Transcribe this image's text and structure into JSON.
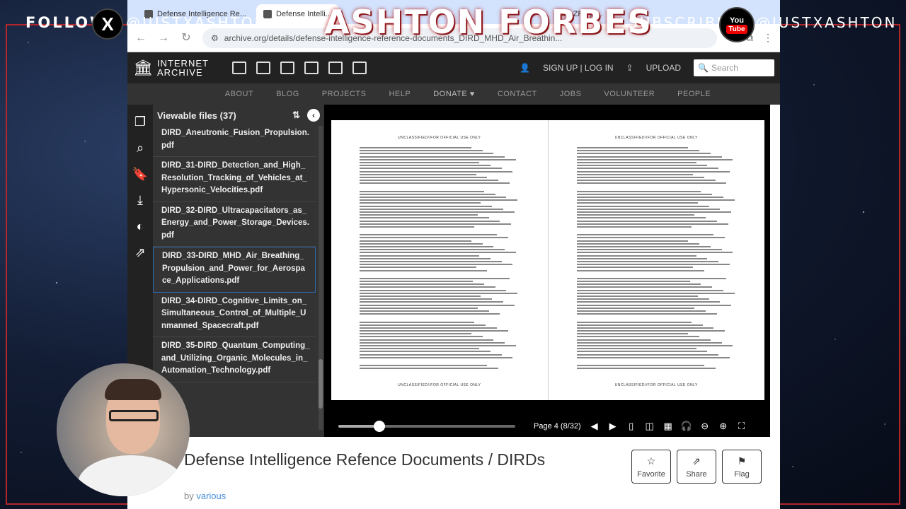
{
  "overlay": {
    "follow_label": "FOLLOW",
    "x_logo": "X",
    "handle_left": "@JUSTXASHTON",
    "title": "ASHTON FORBES",
    "subscribe_label": "SUBSCRIBE",
    "yt_top": "You",
    "yt_bottom": "Tube",
    "handle_right": "@JUSTXASHTON"
  },
  "browser": {
    "tabs": [
      {
        "label": "Defense Intelligence Re..."
      },
      {
        "label": "Defense Intelli..."
      },
      {
        "label": "d's ZPF pr..."
      }
    ],
    "url": "archive.org/details/defense-intelligence-reference-documents_DIRD_MHD_Air_Breathin..."
  },
  "ia": {
    "logo_line1": "INTERNET",
    "logo_line2": "ARCHIVE",
    "signup": "SIGN UP | LOG IN",
    "upload": "UPLOAD",
    "search_placeholder": "Search",
    "nav": [
      "ABOUT",
      "BLOG",
      "PROJECTS",
      "HELP",
      "DONATE ♥",
      "CONTACT",
      "JOBS",
      "VOLUNTEER",
      "PEOPLE"
    ]
  },
  "files": {
    "header": "Viewable files (37)",
    "items": [
      {
        "name": "DIRD_Aneutronic_Fusion_Propulsion.pdf"
      },
      {
        "name": "DIRD_31-DIRD_Detection_and_High_Resolution_Tracking_of_Vehicles_at_Hypersonic_Velocities.pdf"
      },
      {
        "name": "DIRD_32-DIRD_Ultracapacitators_as_Energy_and_Power_Storage_Devices.pdf"
      },
      {
        "name": "DIRD_33-DIRD_MHD_Air_Breathing_Propulsion_and_Power_for_Aerospace_Applications.pdf"
      },
      {
        "name": "DIRD_34-DIRD_Cognitive_Limits_on_Simultaneous_Control_of_Multiple_Unmanned_Spacecraft.pdf"
      },
      {
        "name": "DIRD_35-DIRD_Quantum_Computing_and_Utilizing_Organic_Molecules_in_Automation_Technology.pdf"
      }
    ],
    "selected_index": 3
  },
  "book": {
    "page_label": "Page 4 (8/32)",
    "progress": 0.23,
    "left_header": "UNCLASSIFIED//FOR OFFICIAL USE ONLY",
    "right_header": "UNCLASSIFIED//FOR OFFICIAL USE ONLY",
    "left_footer": "UNCLASSIFIED//FOR OFFICIAL USE ONLY",
    "right_footer": "UNCLASSIFIED//FOR OFFICIAL USE ONLY"
  },
  "item": {
    "title": "Defense Intelligence Refence Documents / DIRDs",
    "by_label": "by",
    "by_value": "various",
    "favorite": "Favorite",
    "share": "Share",
    "flag": "Flag"
  }
}
